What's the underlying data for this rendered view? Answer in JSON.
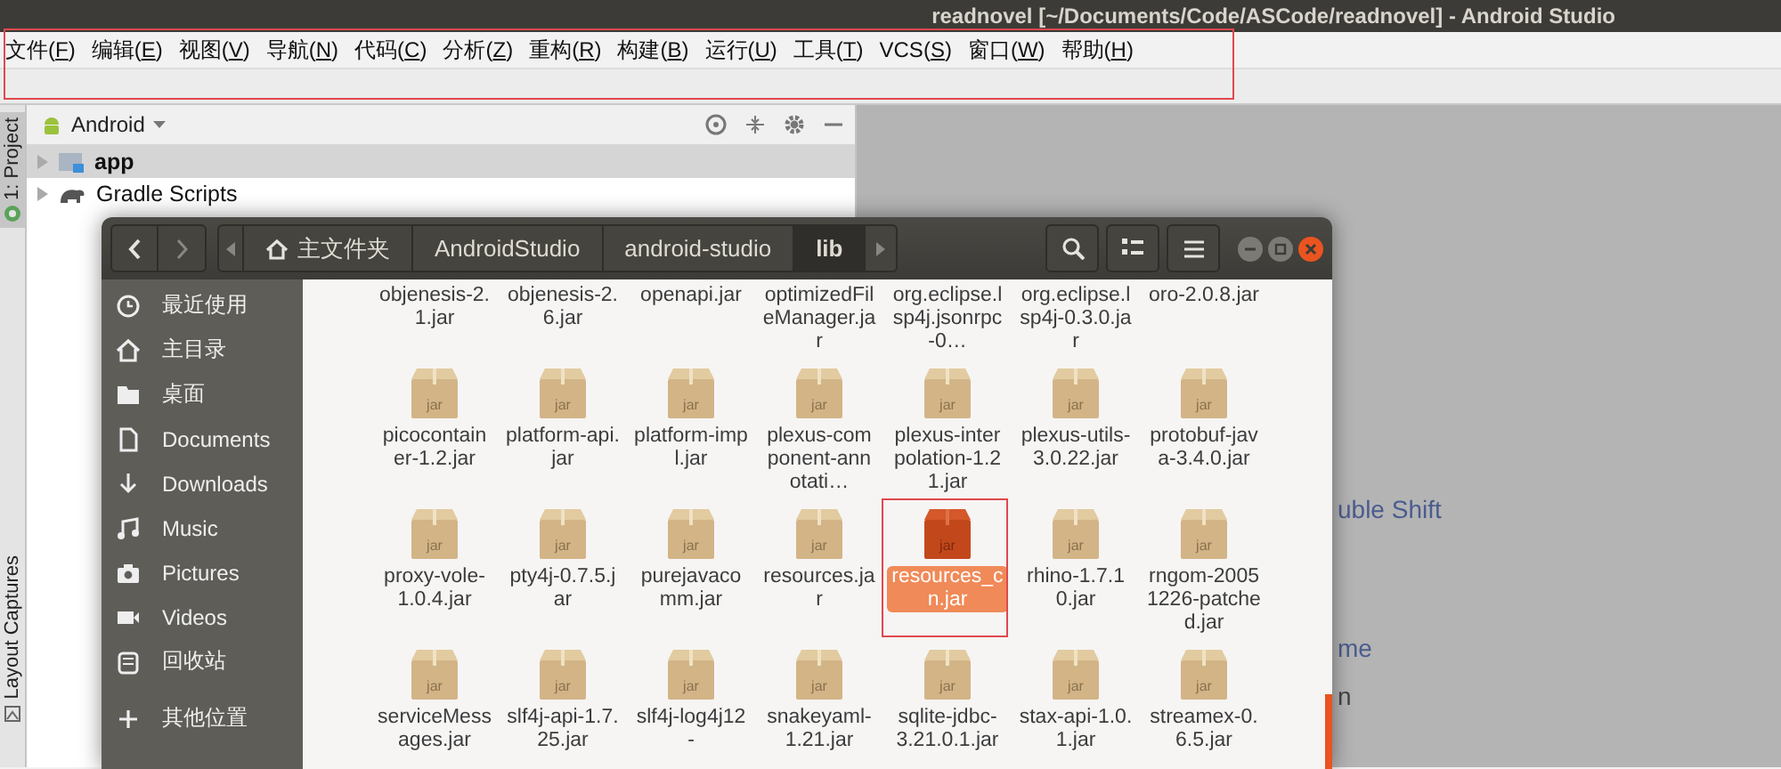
{
  "window": {
    "title": "readnovel [~/Documents/Code/ASCode/readnovel] - Android Studio"
  },
  "menu_bar": {
    "highlighted": true,
    "items": [
      "文件(F)",
      "编辑(E)",
      "视图(V)",
      "导航(N)",
      "代码(C)",
      "分析(Z)",
      "重构(R)",
      "构建(B)",
      "运行(U)",
      "工具(T)",
      "VCS(S)",
      "窗口(W)",
      "帮助(H)"
    ]
  },
  "tool_strip": [
    {
      "label": "1: Project",
      "selected": true,
      "kind": "project"
    },
    {
      "label": "Layout Captures",
      "selected": false,
      "kind": "captures"
    }
  ],
  "project_panel": {
    "view": "Android",
    "tree": [
      {
        "label": "app",
        "selected": true,
        "kind": "module"
      },
      {
        "label": "Gradle Scripts",
        "selected": false,
        "kind": "gradle"
      }
    ]
  },
  "editor": {
    "hints": [
      {
        "text": "uble Shift",
        "kind": "link"
      },
      {
        "text": "me",
        "kind": "link"
      },
      {
        "text": "n",
        "kind": "plain"
      }
    ]
  },
  "file_manager": {
    "path": [
      {
        "label": "主文件夹",
        "kind": "home",
        "selected": false
      },
      {
        "label": "AndroidStudio",
        "kind": "folder",
        "selected": false
      },
      {
        "label": "android-studio",
        "kind": "folder",
        "selected": false
      },
      {
        "label": "lib",
        "kind": "folder",
        "selected": true
      }
    ],
    "sidebar": [
      {
        "label": "最近使用",
        "kind": "recent"
      },
      {
        "label": "主目录",
        "kind": "home"
      },
      {
        "label": "桌面",
        "kind": "desktop"
      },
      {
        "label": "Documents",
        "kind": "documents"
      },
      {
        "label": "Downloads",
        "kind": "downloads"
      },
      {
        "label": "Music",
        "kind": "music"
      },
      {
        "label": "Pictures",
        "kind": "pictures"
      },
      {
        "label": "Videos",
        "kind": "videos"
      },
      {
        "label": "回收站",
        "kind": "trash"
      },
      {
        "label": "其他位置",
        "kind": "other"
      }
    ],
    "files": [
      {
        "name": "objenesis-2.1.jar",
        "kind": "label-only",
        "selected": false,
        "highlighted": false
      },
      {
        "name": "objenesis-2.6.jar",
        "kind": "label-only",
        "selected": false,
        "highlighted": false
      },
      {
        "name": "openapi.jar",
        "kind": "label-only",
        "selected": false,
        "highlighted": false
      },
      {
        "name": "optimizedFileManager.jar",
        "kind": "label-only",
        "selected": false,
        "highlighted": false
      },
      {
        "name": "org.eclipse.lsp4j.jsonrpc-0…",
        "kind": "label-only",
        "selected": false,
        "highlighted": false
      },
      {
        "name": "org.eclipse.lsp4j-0.3.0.jar",
        "kind": "label-only",
        "selected": false,
        "highlighted": false
      },
      {
        "name": "oro-2.0.8.jar",
        "kind": "label-only",
        "selected": false,
        "highlighted": false
      },
      {
        "name": "picocontainer-1.2.jar",
        "kind": "jar",
        "badge": "jar",
        "selected": false,
        "highlighted": false
      },
      {
        "name": "platform-api.jar",
        "kind": "jar",
        "badge": "jar",
        "selected": false,
        "highlighted": false
      },
      {
        "name": "platform-impl.jar",
        "kind": "jar",
        "badge": "jar",
        "selected": false,
        "highlighted": false
      },
      {
        "name": "plexus-component-annotati…",
        "kind": "jar",
        "badge": "jar",
        "selected": false,
        "highlighted": false
      },
      {
        "name": "plexus-interpolation-1.21.jar",
        "kind": "jar",
        "badge": "jar",
        "selected": false,
        "highlighted": false
      },
      {
        "name": "plexus-utils-3.0.22.jar",
        "kind": "jar",
        "badge": "jar",
        "selected": false,
        "highlighted": false
      },
      {
        "name": "protobuf-java-3.4.0.jar",
        "kind": "jar",
        "badge": "jar",
        "selected": false,
        "highlighted": false
      },
      {
        "name": "proxy-vole-1.0.4.jar",
        "kind": "jar",
        "badge": "jar",
        "selected": false,
        "highlighted": false
      },
      {
        "name": "pty4j-0.7.5.jar",
        "kind": "jar",
        "badge": "jar",
        "selected": false,
        "highlighted": false
      },
      {
        "name": "purejavacomm.jar",
        "kind": "jar",
        "badge": "jar",
        "selected": false,
        "highlighted": false
      },
      {
        "name": "resources.jar",
        "kind": "jar",
        "badge": "jar",
        "selected": false,
        "highlighted": false
      },
      {
        "name": "resources_cn.jar",
        "kind": "jar",
        "badge": "jar",
        "selected": true,
        "highlighted": true
      },
      {
        "name": "rhino-1.7.10.jar",
        "kind": "jar",
        "badge": "jar",
        "selected": false,
        "highlighted": false
      },
      {
        "name": "rngom-20051226-patched.jar",
        "kind": "jar",
        "badge": "jar",
        "selected": false,
        "highlighted": false
      },
      {
        "name": "serviceMessages.jar",
        "kind": "jar",
        "badge": "jar",
        "selected": false,
        "highlighted": false
      },
      {
        "name": "slf4j-api-1.7.25.jar",
        "kind": "jar",
        "badge": "jar",
        "selected": false,
        "highlighted": false
      },
      {
        "name": "slf4j-log4j12-",
        "kind": "jar",
        "badge": "jar",
        "selected": false,
        "highlighted": false
      },
      {
        "name": "snakeyaml-1.21.jar",
        "kind": "jar",
        "badge": "jar",
        "selected": false,
        "highlighted": false
      },
      {
        "name": "sqlite-jdbc-3.21.0.1.jar",
        "kind": "jar",
        "badge": "jar",
        "selected": false,
        "highlighted": false
      },
      {
        "name": "stax-api-1.0.1.jar",
        "kind": "jar",
        "badge": "jar",
        "selected": false,
        "highlighted": false
      },
      {
        "name": "streamex-0.6.5.jar",
        "kind": "jar",
        "badge": "jar",
        "selected": false,
        "highlighted": false
      }
    ]
  }
}
